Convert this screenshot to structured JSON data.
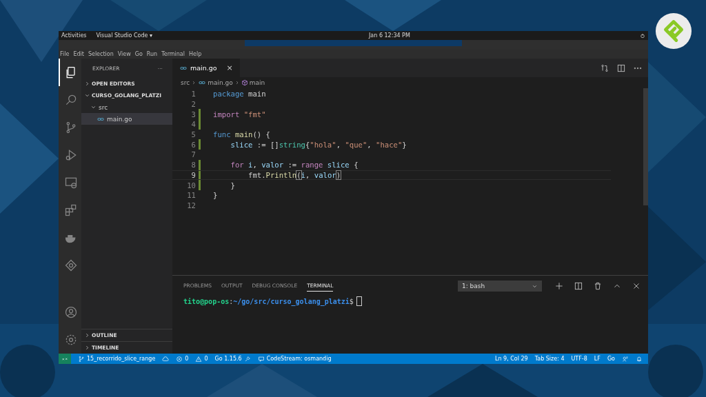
{
  "topbar": {
    "activities": "Activities",
    "app_menu": "Visual Studio Code ▾",
    "clock": "Jan 6  12:34 PM"
  },
  "menu": [
    "File",
    "Edit",
    "Selection",
    "View",
    "Go",
    "Run",
    "Terminal",
    "Help"
  ],
  "activity_bar": [
    {
      "selected": true
    },
    {
      "selected": false
    },
    {
      "selected": false
    },
    {
      "selected": false
    },
    {
      "selected": false
    },
    {
      "selected": false
    },
    {
      "selected": false
    },
    {
      "selected": false
    }
  ],
  "sidebar": {
    "title": "EXPLORER",
    "more": "···",
    "sections": [
      {
        "label": "OPEN EDITORS",
        "expanded": false
      },
      {
        "label": "CURSO_GOLANG_PLATZI",
        "expanded": true,
        "children": [
          {
            "label": "src",
            "kind": "folder",
            "expanded": true,
            "children": [
              {
                "label": "main.go",
                "kind": "go",
                "selected": true
              }
            ]
          }
        ]
      }
    ],
    "bottom_sections": [
      {
        "label": "OUTLINE",
        "expanded": false
      },
      {
        "label": "TIMELINE",
        "expanded": false
      }
    ]
  },
  "tabs": [
    {
      "label": "main.go",
      "selected": true,
      "close": "×"
    }
  ],
  "breadcrumb": [
    "src",
    "main.go",
    "main"
  ],
  "code": [
    {
      "number": "1",
      "changed": false,
      "active": false,
      "tokens": [
        {
          "text": "package",
          "kind": "kw"
        },
        {
          "text": " main",
          "kind": "plain"
        }
      ]
    },
    {
      "number": "2",
      "changed": false,
      "active": false
    },
    {
      "number": "3",
      "changed": true,
      "active": false,
      "tokens": [
        {
          "text": "import",
          "kind": "ctrl"
        },
        {
          "text": " \"fmt\"",
          "kind": "str"
        }
      ]
    },
    {
      "number": "4",
      "changed": true,
      "active": false
    },
    {
      "number": "5",
      "changed": false,
      "active": false,
      "tokens": [
        {
          "text": "func",
          "kind": "kw"
        },
        {
          "text": " main",
          "kind": "fn"
        },
        {
          "text": "() {",
          "kind": "plain"
        }
      ]
    },
    {
      "number": "6",
      "changed": true,
      "active": false,
      "tokens": [
        {
          "text": "    slice",
          "kind": "var"
        },
        {
          "text": " := []",
          "kind": "plain"
        },
        {
          "text": "string",
          "kind": "type"
        },
        {
          "text": "{",
          "kind": "plain"
        },
        {
          "text": "\"hola\"",
          "kind": "str"
        },
        {
          "text": ", ",
          "kind": "plain"
        },
        {
          "text": "\"que\"",
          "kind": "str"
        },
        {
          "text": ", ",
          "kind": "plain"
        },
        {
          "text": "\"hace\"",
          "kind": "str"
        },
        {
          "text": "}",
          "kind": "plain"
        }
      ]
    },
    {
      "number": "7",
      "changed": false,
      "active": false
    },
    {
      "number": "8",
      "changed": true,
      "active": false,
      "tokens": [
        {
          "text": "    for",
          "kind": "ctrl"
        },
        {
          "text": " i",
          "kind": "var"
        },
        {
          "text": ", ",
          "kind": "plain"
        },
        {
          "text": "valor",
          "kind": "var"
        },
        {
          "text": " := ",
          "kind": "plain"
        },
        {
          "text": "range",
          "kind": "ctrl"
        },
        {
          "text": " slice",
          "kind": "var"
        },
        {
          "text": " {",
          "kind": "plain"
        }
      ]
    },
    {
      "number": "9",
      "changed": true,
      "active": true,
      "tokens": [
        {
          "text": "        fmt",
          "kind": "plain"
        },
        {
          "text": ".",
          "kind": "plain"
        },
        {
          "text": "Println",
          "kind": "fn"
        },
        {
          "text": "(",
          "kind": "match"
        },
        {
          "text": "i",
          "kind": "var"
        },
        {
          "text": ", ",
          "kind": "plain"
        },
        {
          "text": "valor",
          "kind": "var"
        },
        {
          "text": ")",
          "kind": "match"
        }
      ]
    },
    {
      "number": "10",
      "changed": true,
      "active": false,
      "tokens": [
        {
          "text": "    }",
          "kind": "plain"
        }
      ]
    },
    {
      "number": "11",
      "changed": false,
      "active": false,
      "tokens": [
        {
          "text": "}",
          "kind": "plain"
        }
      ]
    },
    {
      "number": "12",
      "changed": false,
      "active": false
    }
  ],
  "panel": {
    "tabs": [
      {
        "label": "PROBLEMS",
        "selected": false
      },
      {
        "label": "OUTPUT",
        "selected": false
      },
      {
        "label": "DEBUG CONSOLE",
        "selected": false
      },
      {
        "label": "TERMINAL",
        "selected": true
      }
    ],
    "terminal_select": "1: bash",
    "prompt": {
      "user": "tito@pop-os",
      "sep": ":",
      "path": "~/go/src/curso_golang_platzi",
      "symbol": "$"
    }
  },
  "status_bar": {
    "left": [
      {
        "text": "15_recorrido_slice_range",
        "kind": "branch"
      },
      {
        "kind": "sync"
      },
      {
        "text": "0",
        "kind": "errors"
      },
      {
        "text": "0",
        "kind": "warnings"
      },
      {
        "text": "Go 1.15.6",
        "kind": "go"
      },
      {
        "text": "CodeStream: osmandig",
        "kind": "chat"
      }
    ],
    "right": [
      "Ln 9, Col 29",
      "Tab Size: 4",
      "UTF-8",
      "LF",
      "Go"
    ]
  }
}
